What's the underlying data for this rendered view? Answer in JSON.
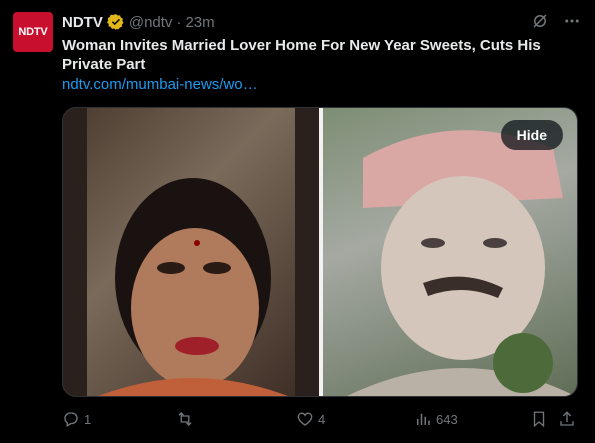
{
  "author": {
    "avatar_text": "NDTV",
    "name": "NDTV",
    "handle": "@ndtv",
    "separator": "·",
    "time": "23m"
  },
  "tweet": {
    "text": "Woman Invites Married Lover Home For New Year Sweets, Cuts His Private Part",
    "link": "ndtv.com/mumbai-news/wo…"
  },
  "media": {
    "hide_label": "Hide",
    "left_image_icon": "photo-woman",
    "right_image_icon": "photo-man"
  },
  "actions": {
    "replies": "1",
    "reposts": "",
    "likes": "4",
    "views": "643"
  },
  "colors": {
    "background": "#000000",
    "text": "#e7e9ea",
    "muted": "#71767b",
    "link": "#1d9bf0",
    "brand": "#c8102e",
    "verified": "#e2b719"
  }
}
